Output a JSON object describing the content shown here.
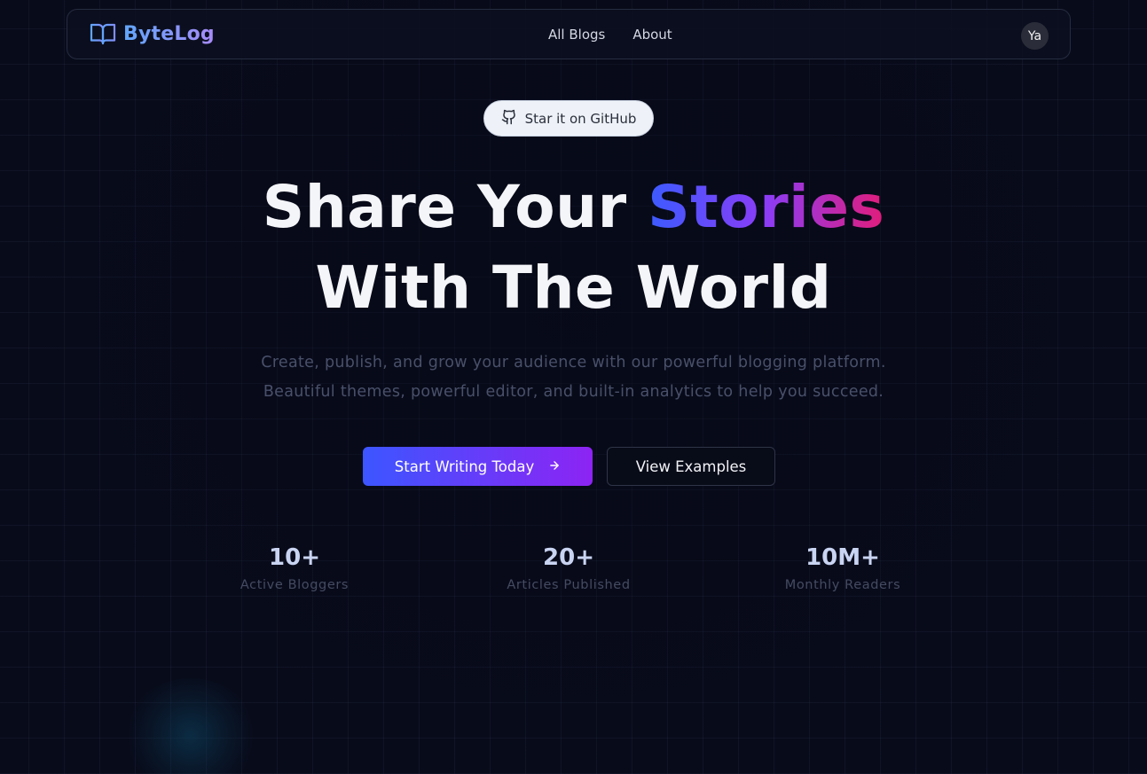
{
  "navbar": {
    "brand": "ByteLog",
    "links": [
      "All Blogs",
      "About"
    ],
    "avatar_initials": "Ya"
  },
  "github_pill": {
    "label": "Star it on GitHub",
    "icon": "github-icon"
  },
  "hero": {
    "headline_part1": "Share Your ",
    "headline_highlight": "Stories",
    "headline_line2": "With The World",
    "subtitle_line1": "Create, publish, and grow your audience with our powerful blogging platform.",
    "subtitle_line2": "Beautiful themes, powerful editor, and built-in analytics to help you succeed."
  },
  "buttons": {
    "primary": "Start Writing Today",
    "primary_icon": "arrow-right-icon",
    "secondary": "View Examples"
  },
  "stats": [
    {
      "value": "10+",
      "label": "Active Bloggers"
    },
    {
      "value": "20+",
      "label": "Articles Published"
    },
    {
      "value": "10M+",
      "label": "Monthly Readers"
    }
  ],
  "colors": {
    "background": "#080b1a",
    "brand_gradient": [
      "#60a5fa",
      "#a78bfa"
    ],
    "highlight_gradient": [
      "#3b5bff",
      "#8b3cf6",
      "#e11d7a"
    ],
    "primary_button_gradient": [
      "#3c56ff",
      "#8d24f4"
    ]
  }
}
